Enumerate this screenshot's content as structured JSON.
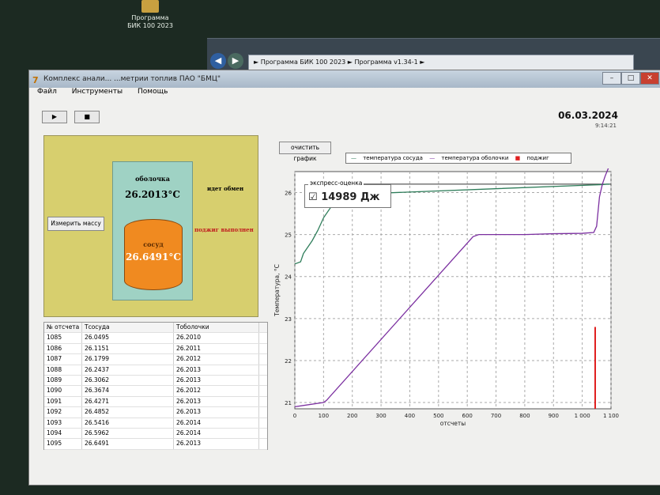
{
  "desktop": {
    "icon_label_1": "Программа",
    "icon_label_2": "БИК 100 2023"
  },
  "explorer": {
    "path": "► Программа БИК 100 2023 ► Программа v1.34-1 ►"
  },
  "window": {
    "title": "Комплекс анали... ...метрии топлив ПАО \"БМЦ\"",
    "menu": [
      "Файл",
      "Инструменты",
      "Помощь"
    ],
    "toolbar": [
      "▶",
      "■"
    ],
    "date": "06.03.2024",
    "time": "9:14:21"
  },
  "panel": {
    "shell_label": "оболочка",
    "shell_temp": "26.2013°C",
    "vessel_label": "сосуд",
    "vessel_temp": "26.6491°C",
    "status_exchange": "идет обмен",
    "status_ignition": "поджиг выполнен",
    "measure_button": "Измерить массу"
  },
  "table": {
    "headers": [
      "№ отсчета",
      "Тсосуда",
      "Тоболочки"
    ],
    "rows": [
      [
        "1085",
        "26.0495",
        "26.2010"
      ],
      [
        "1086",
        "26.1151",
        "26.2011"
      ],
      [
        "1087",
        "26.1799",
        "26.2012"
      ],
      [
        "1088",
        "26.2437",
        "26.2013"
      ],
      [
        "1089",
        "26.3062",
        "26.2013"
      ],
      [
        "1090",
        "26.3674",
        "26.2012"
      ],
      [
        "1091",
        "26.4271",
        "26.2013"
      ],
      [
        "1092",
        "26.4852",
        "26.2013"
      ],
      [
        "1093",
        "26.5416",
        "26.2014"
      ],
      [
        "1094",
        "26.5962",
        "26.2014"
      ],
      [
        "1095",
        "26.6491",
        "26.2013"
      ]
    ]
  },
  "chart_controls": {
    "clear_button": "очистить график",
    "express_title": "экспресс-оценка",
    "express_value": "14989 Дж",
    "express_check": "☑"
  },
  "chart_data": {
    "type": "line",
    "xlabel": "отсчеты",
    "ylabel": "Температура, °С",
    "xlim": [
      0,
      1100
    ],
    "ylim": [
      20.85,
      26.5
    ],
    "xticks": [
      0,
      100,
      200,
      300,
      400,
      500,
      600,
      700,
      800,
      900,
      1000,
      1100
    ],
    "xtick_labels": [
      "0",
      "100",
      "200",
      "300",
      "400",
      "500",
      "600",
      "700",
      "800",
      "900",
      "1 000",
      "1 100"
    ],
    "yticks": [
      21,
      22,
      23,
      24,
      25,
      26
    ],
    "series": [
      {
        "name": "температура сосуда",
        "color": "#2e7d5a",
        "x": [
          0,
          20,
          30,
          40,
          60,
          80,
          100,
          130,
          160,
          1030,
          1070,
          1085,
          1095
        ],
        "y": [
          24.3,
          24.35,
          24.55,
          24.65,
          24.85,
          25.1,
          25.4,
          25.7,
          25.95,
          26.18,
          26.19,
          26.2,
          26.2
        ]
      },
      {
        "name": "температура оболочки",
        "color": "#7b2fa0",
        "x": [
          0,
          100,
          110,
          620,
          640,
          700,
          800,
          900,
          1000,
          1040,
          1050,
          1060,
          1070,
          1080,
          1095
        ],
        "y": [
          20.9,
          21.0,
          21.05,
          24.95,
          25.0,
          25.0,
          25.0,
          25.02,
          25.03,
          25.05,
          25.2,
          25.9,
          26.2,
          26.4,
          26.65
        ]
      },
      {
        "name": "поджиг",
        "color": "#e02020",
        "x": [
          1045
        ],
        "y": [
          22.8
        ]
      }
    ],
    "grid": true,
    "legend": "top"
  }
}
